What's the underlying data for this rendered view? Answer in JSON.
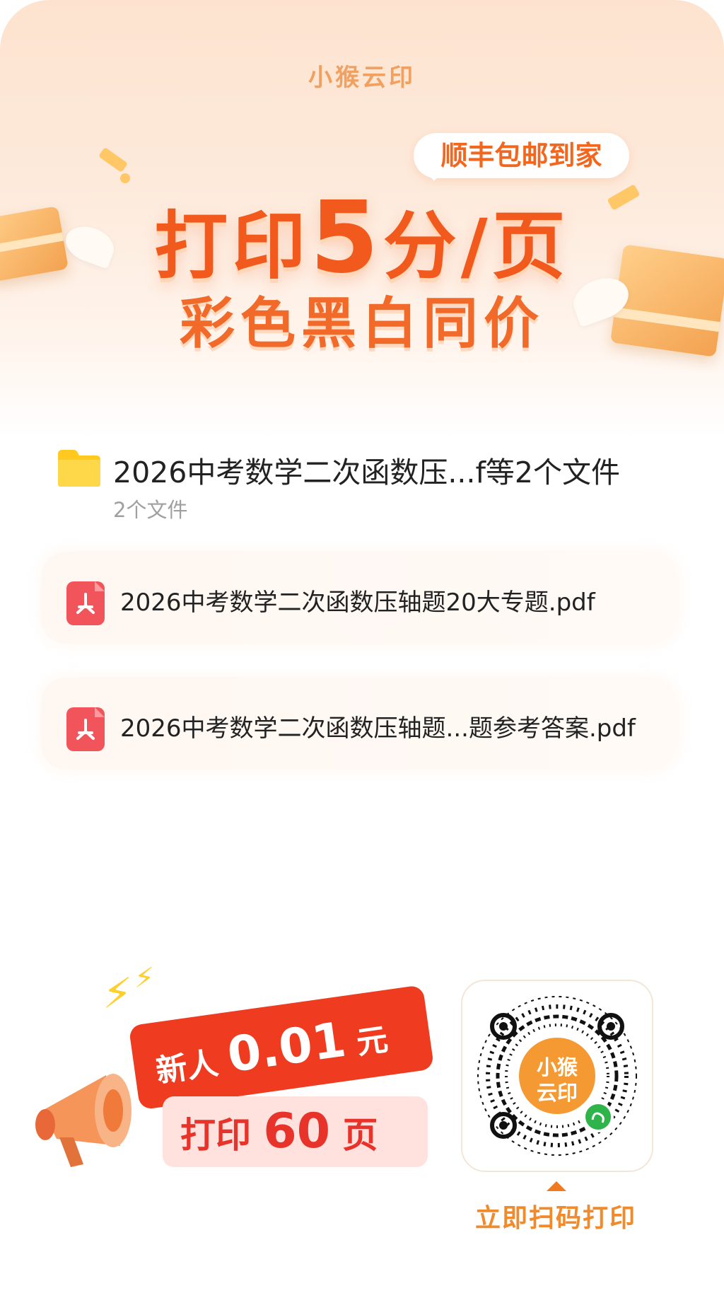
{
  "header": {
    "brand": "小猴云印",
    "badge": "顺丰包邮到家",
    "headline_prefix": "打印",
    "headline_number": "5",
    "headline_suffix": "分/页",
    "subheadline": "彩色黑白同价"
  },
  "folder": {
    "icon": "folder-icon",
    "title": "2026中考数学二次函数压...f等2个文件",
    "subtitle": "2个文件"
  },
  "files": [
    {
      "icon": "pdf-icon",
      "name": "2026中考数学二次函数压轴题20大专题.pdf"
    },
    {
      "icon": "pdf-icon",
      "name": "2026中考数学二次函数压轴题...题参考答案.pdf"
    }
  ],
  "promo": {
    "line1_prefix": "新人",
    "line1_amount": "0.01",
    "line1_unit": "元",
    "line2_prefix": "打印",
    "line2_amount": "60",
    "line2_unit": "页",
    "icon": "megaphone-icon"
  },
  "qr": {
    "center_label": "小猴云印",
    "icon": "qr-code-icon",
    "cta": "立即扫码打印"
  },
  "colors": {
    "accent": "#f15a1c",
    "pdf": "#f2545b",
    "folder": "#ffc91f",
    "cta": "#f08a2a"
  }
}
